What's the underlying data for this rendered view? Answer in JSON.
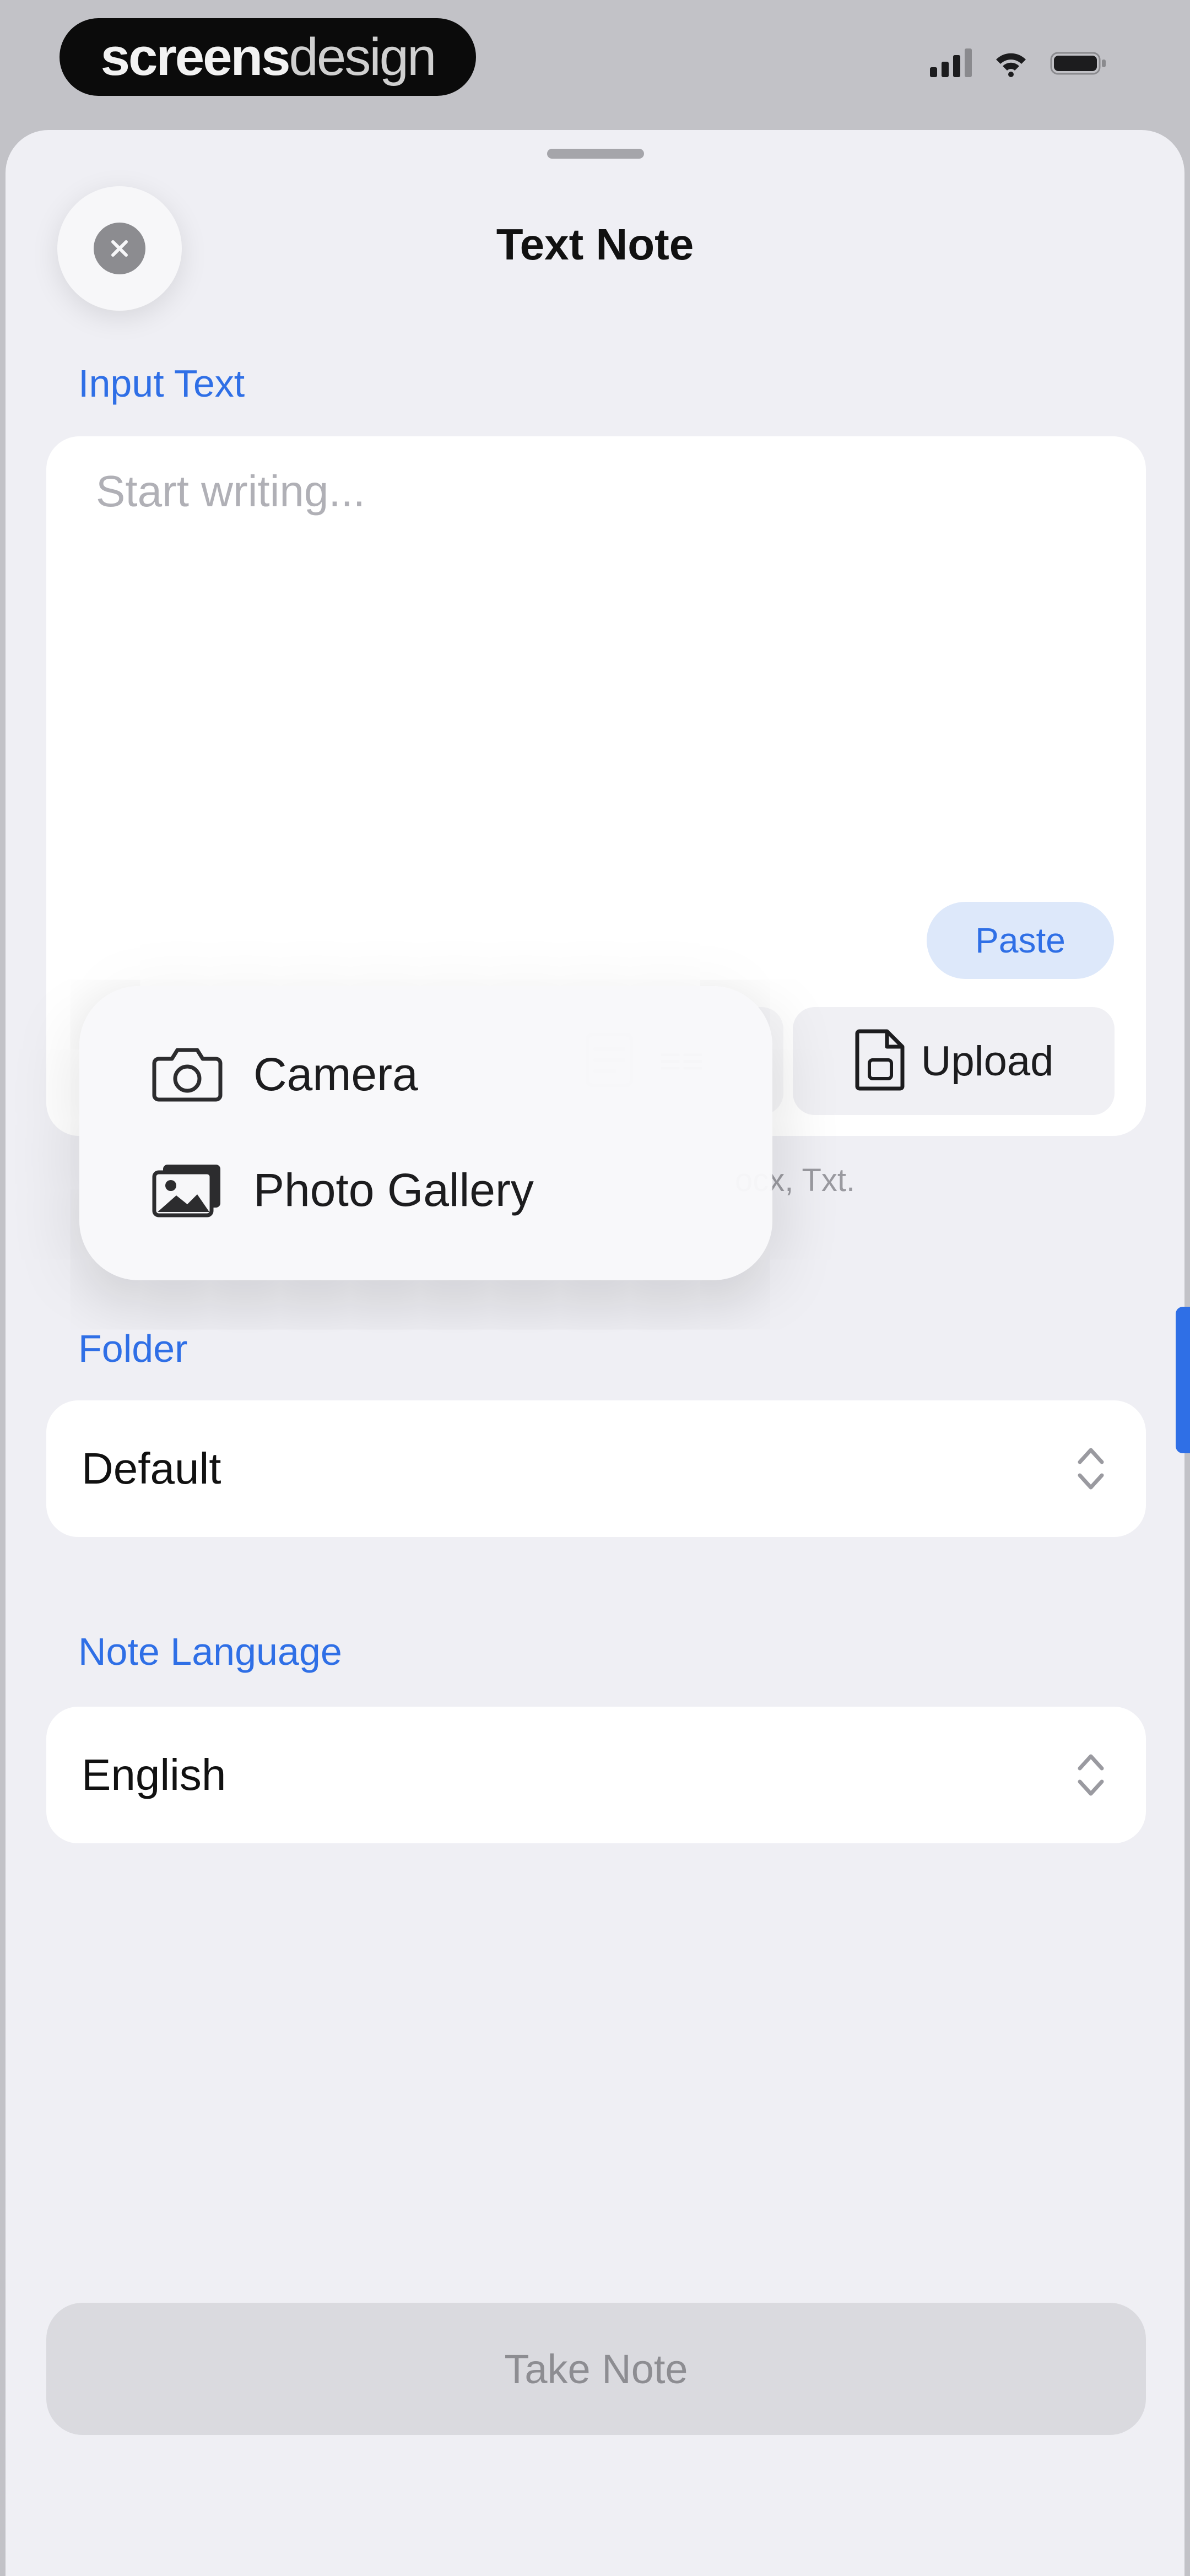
{
  "status_bar": {
    "brand_bold": "screens",
    "brand_light": "design",
    "icons": [
      "signal-icon",
      "wifi-icon",
      "battery-icon"
    ]
  },
  "header": {
    "title": "Text Note",
    "close_icon": "close-icon"
  },
  "input_section": {
    "label": "Input Text",
    "placeholder": "Start writing...",
    "paste_label": "Paste",
    "scan_icon": "scan-document-icon",
    "upload_label": "Upload",
    "upload_icon": "document-icon",
    "supported_note": "ocx, Txt."
  },
  "menu": {
    "items": [
      {
        "label": "Camera",
        "icon": "camera-icon"
      },
      {
        "label": "Photo Gallery",
        "icon": "photo-icon"
      }
    ]
  },
  "folder": {
    "label": "Folder",
    "value": "Default",
    "icon": "chevron-up-down-icon"
  },
  "language": {
    "label": "Note Language",
    "value": "English",
    "icon": "chevron-up-down-icon"
  },
  "cta": {
    "label": "Take Note"
  },
  "colors": {
    "accent": "#2f6fe6",
    "sheet_bg": "#efeff4",
    "card_bg": "#ffffff",
    "disabled_button": "#dadadf"
  }
}
